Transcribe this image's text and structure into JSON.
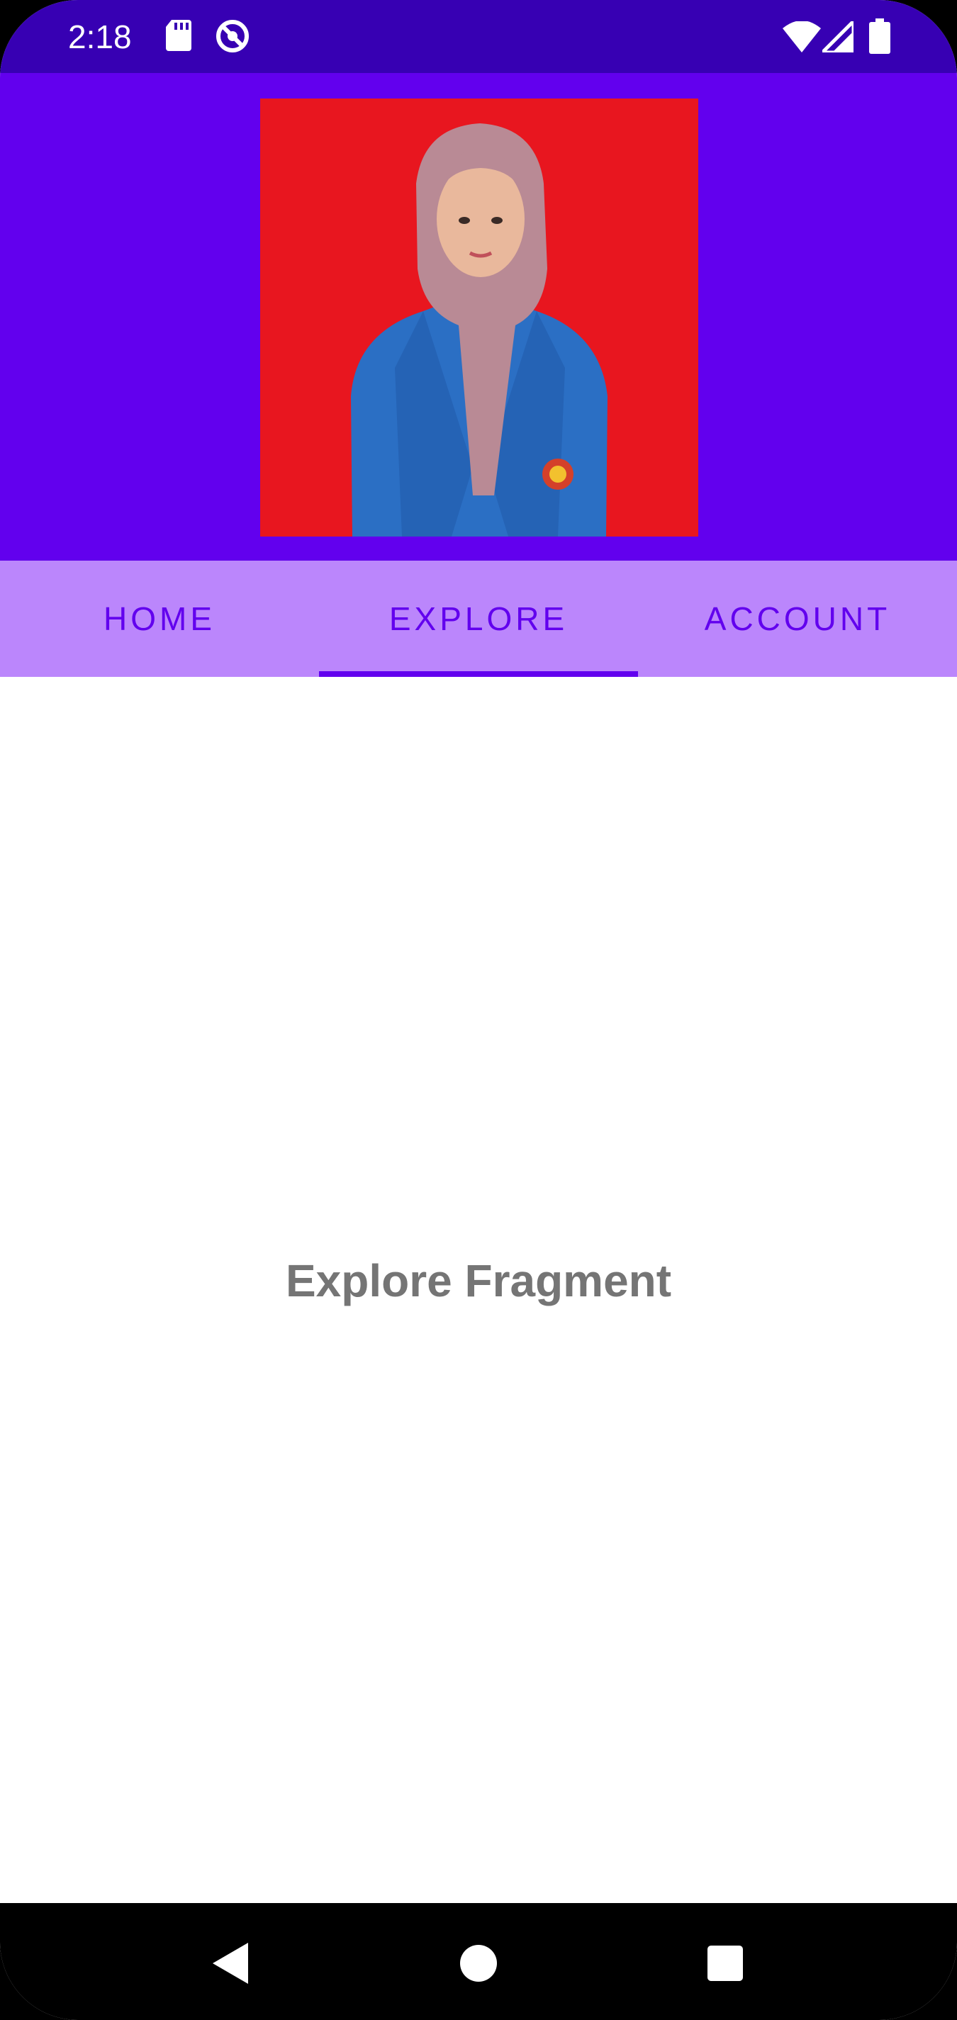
{
  "status_bar": {
    "time": "2:18",
    "left_icons": [
      "sd-card-icon",
      "do-not-disturb-icon"
    ],
    "right_icons": [
      "wifi-icon",
      "cell-signal-icon",
      "battery-icon"
    ]
  },
  "header": {
    "photo": "profile-photo",
    "photo_background": "#E8161F"
  },
  "tabs": [
    {
      "label": "HOME",
      "active": false
    },
    {
      "label": "EXPLORE",
      "active": true
    },
    {
      "label": "ACCOUNT",
      "active": false
    }
  ],
  "content": {
    "label": "Explore Fragment"
  },
  "nav_bar": {
    "buttons": [
      "back-icon",
      "home-circle-icon",
      "recents-square-icon"
    ]
  },
  "colors": {
    "status_bar": "#3700B3",
    "primary": "#6200EE",
    "tab_background": "#BB86FC",
    "text_gray": "#757575"
  }
}
